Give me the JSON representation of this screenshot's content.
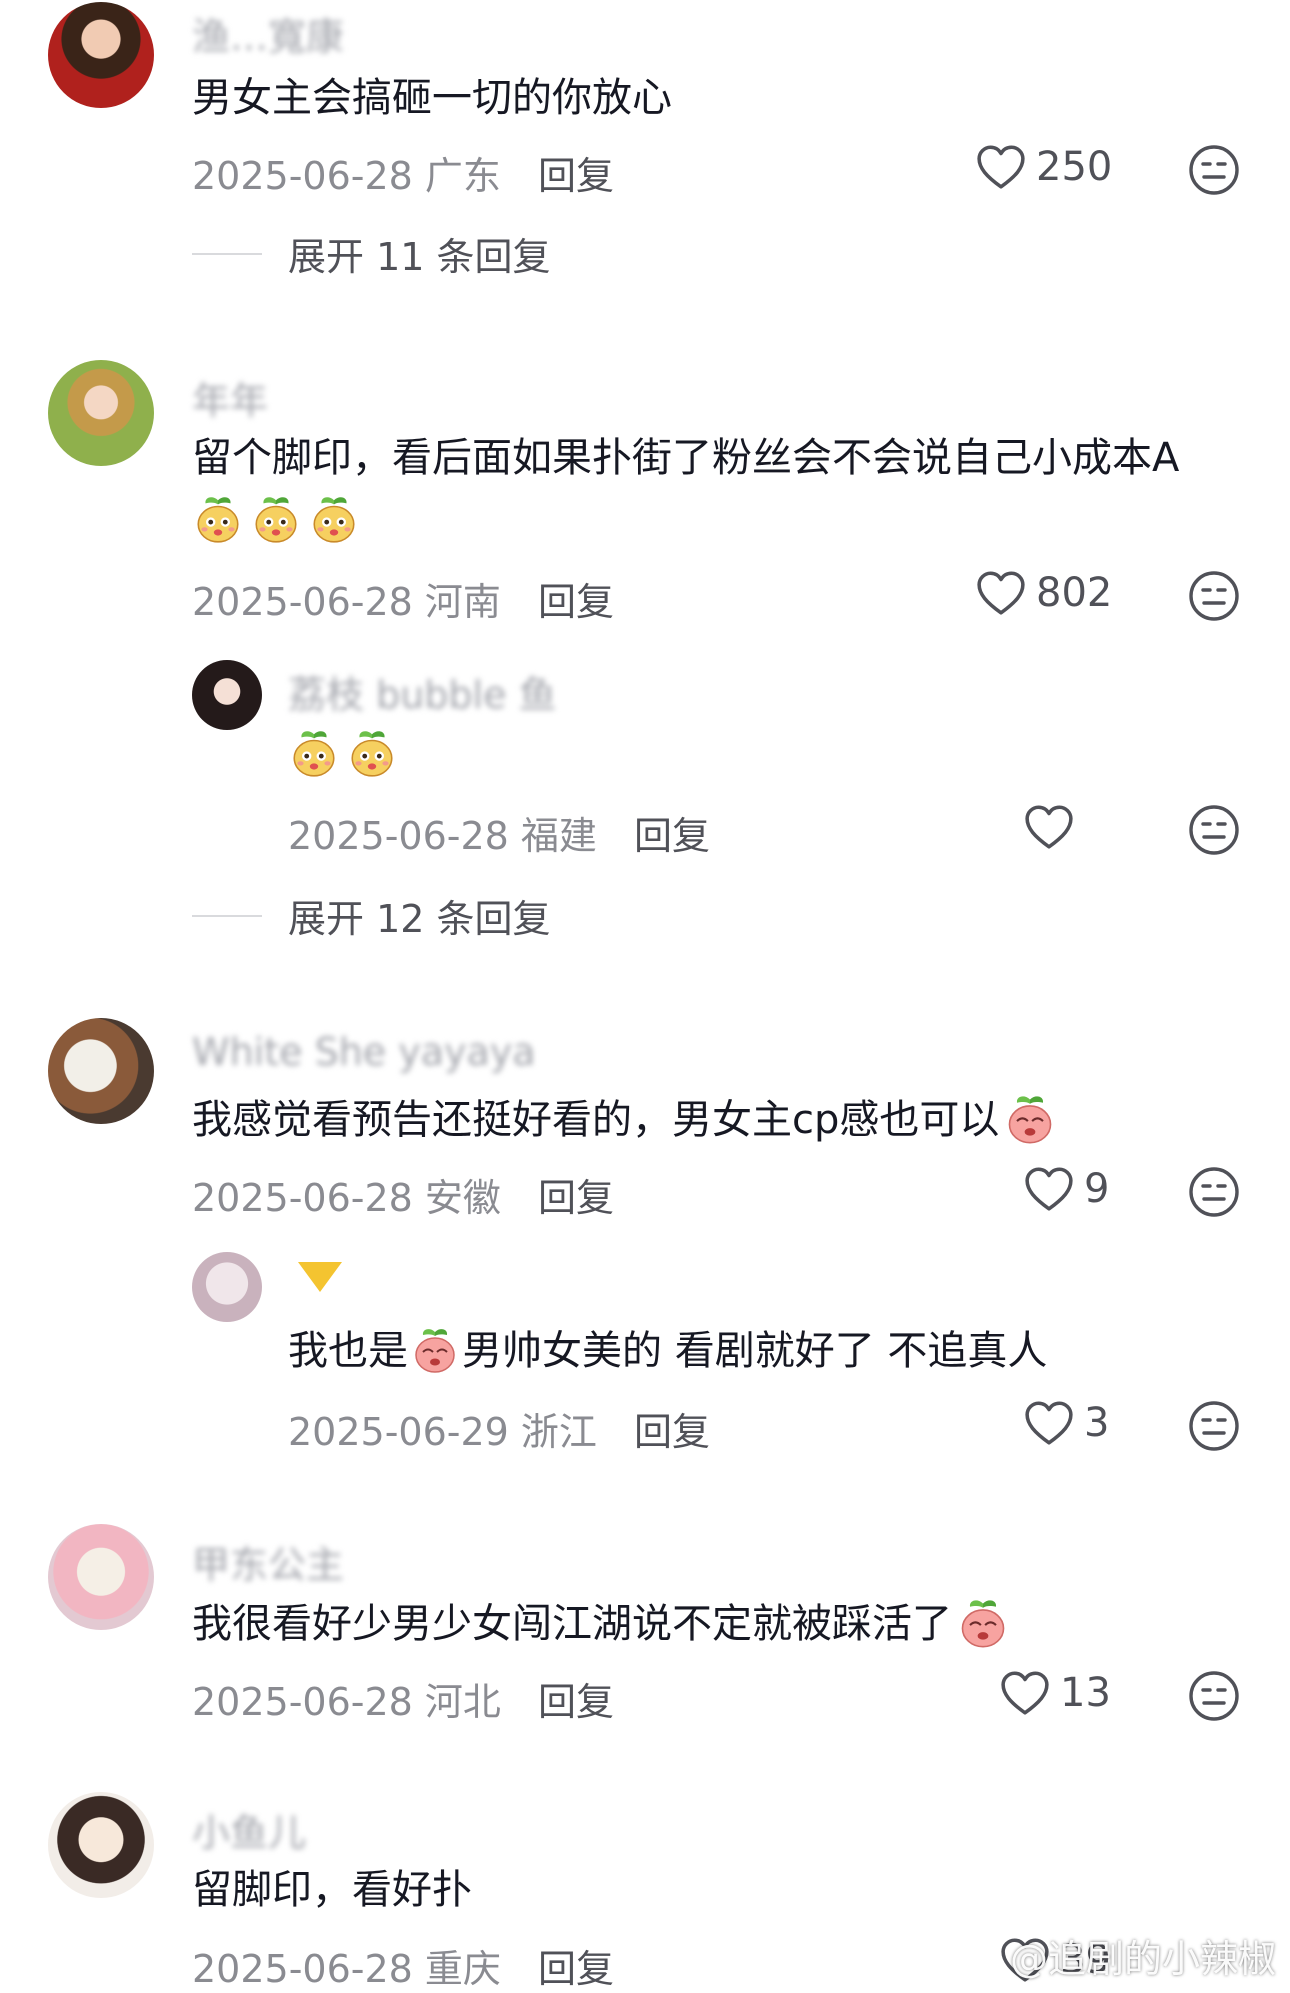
{
  "comments": [
    {
      "name": "渔…寬康",
      "text": "男女主会搞砸一切的你放心",
      "date": "2025-06-28 广东",
      "reply": "回复",
      "likes": "250",
      "expand": "展开 11 条回复"
    },
    {
      "name": "年年",
      "text": "留个脚印，看后面如果扑街了粉丝会不会说自己小成本A",
      "date": "2025-06-28 河南",
      "reply": "回复",
      "likes": "802",
      "sub": {
        "name": "荔枝 bubble 鱼",
        "date": "2025-06-28 福建",
        "reply": "回复",
        "likes": ""
      },
      "expand": "展开 12 条回复"
    },
    {
      "name": "White She yayaya",
      "text": "我感觉看预告还挺好看的，男女主cp感也可以",
      "date": "2025-06-28 安徽",
      "reply": "回复",
      "likes": "9",
      "sub": {
        "text_a": "我也是",
        "text_b": "男帅女美的 看剧就好了 不追真人",
        "date": "2025-06-29 浙江",
        "reply": "回复",
        "likes": "3"
      }
    },
    {
      "name": "甲东公主",
      "text": "我很看好少男少女闯江湖说不定就被踩活了",
      "date": "2025-06-28 河北",
      "reply": "回复",
      "likes": "13"
    },
    {
      "name": "小鱼儿",
      "text": "留脚印，看好扑",
      "date": "2025-06-28 重庆",
      "reply": "回复",
      "likes": "39"
    }
  ],
  "watermark": "@追剧的小辣椒",
  "icons": {
    "like": "heart-outline-icon",
    "dislike": "neutral-face-icon",
    "sticker": "peach-face-sticker"
  },
  "colors": {
    "text": "#161823",
    "meta": "#8a8b91",
    "action": "#505158"
  }
}
